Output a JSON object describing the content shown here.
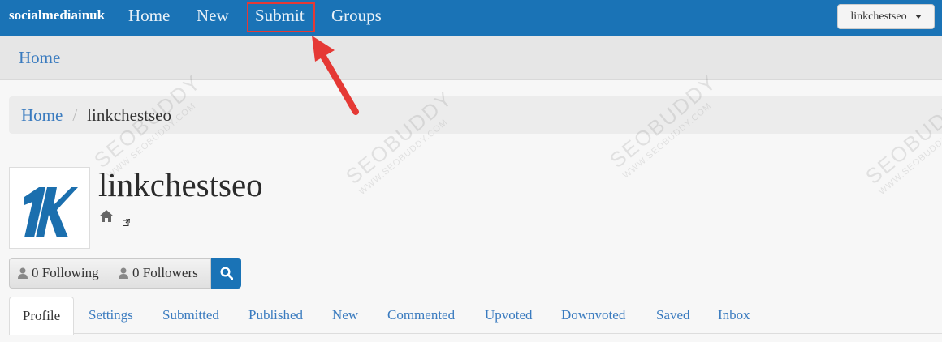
{
  "navbar": {
    "brand": "socialmediainuk",
    "links": [
      "Home",
      "New",
      "Submit",
      "Groups"
    ],
    "user": "linkchestseo"
  },
  "subheader": {
    "title": "Home"
  },
  "breadcrumb": {
    "home": "Home",
    "separator": "/",
    "current": "linkchestseo"
  },
  "profile": {
    "name": "linkchestseo",
    "following": "0 Following",
    "followers": "0 Followers",
    "home_icon": "home-icon",
    "external_link_icon": "external-link-icon"
  },
  "tabs": {
    "items": [
      "Profile",
      "Settings",
      "Submitted",
      "Published",
      "New",
      "Commented",
      "Upvoted",
      "Downvoted",
      "Saved",
      "Inbox"
    ],
    "active": "Profile"
  },
  "watermark": {
    "brand": "SEOBUDDY",
    "url": "WWW.SEOBUDDY.COM"
  },
  "colors": {
    "navbar": "#1a73b6",
    "link": "#3a7bbf",
    "highlight": "#e53935",
    "logo": "#1b6fae"
  }
}
